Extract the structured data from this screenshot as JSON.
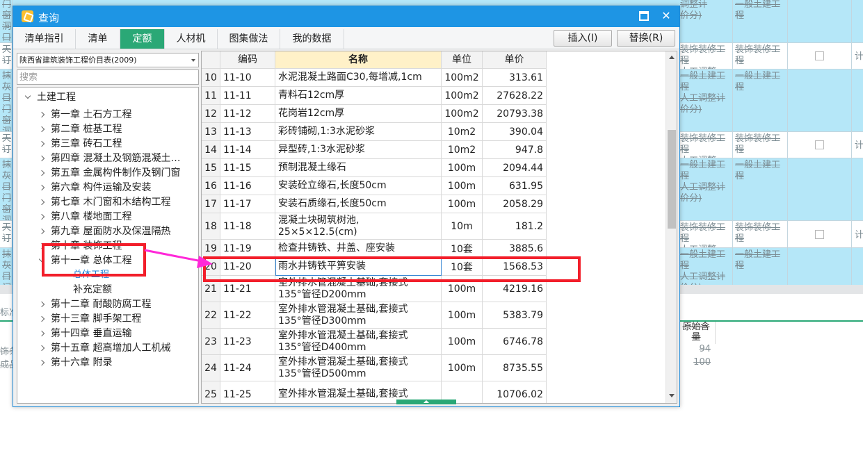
{
  "background": {
    "rows": [
      {
        "col1": "调整计\n价分)",
        "col2": "一般土建工\n程",
        "type": "blue"
      },
      {
        "col1": "装饰装修工程\n人工调整…",
        "col2": "装饰装修工\n程",
        "type": "white"
      },
      {
        "col1": "一般土建工程\n人工调整计\n价分)",
        "col2": "一般土建工\n程",
        "type": "blue"
      },
      {
        "col1": "装饰装修工程\n人工调整…",
        "col2": "装饰装修工\n程",
        "type": "white"
      },
      {
        "col1": "一般土建工程\n人工调整计\n价分)",
        "col2": "一般土建工\n程",
        "type": "blue"
      },
      {
        "col1": "装饰装修工程\n人工调整…",
        "col2": "装饰装修工\n程",
        "type": "white"
      },
      {
        "col1": "一般土建工程\n人工调整计\n价分)",
        "col2": "一般土建工\n程",
        "type": "blue"
      }
    ],
    "left_fragments": [
      "门窗\n洞口\n五金",
      "天订",
      "抹灰\n目\n门窗\n洞口\n五金",
      "天订",
      "抹灰\n目\n门窗\n洞口\n五金",
      "天订",
      "抹灰\n目\n门窗"
    ],
    "right_label": "计",
    "strip_left": "标准",
    "lower": {
      "header": "原始含\n量",
      "values": [
        "94",
        "100"
      ],
      "left_labels": [
        "饰条",
        "成品"
      ]
    }
  },
  "dialog": {
    "title": "查询",
    "minimize_icon": "minimize-icon",
    "close_label": "✕",
    "tabs": [
      {
        "label": "清单指引",
        "active": false
      },
      {
        "label": "清单",
        "active": false
      },
      {
        "label": "定额",
        "active": true
      },
      {
        "label": "人材机",
        "active": false
      },
      {
        "label": "图集做法",
        "active": false
      },
      {
        "label": "我的数据",
        "active": false
      }
    ],
    "insert_button": "插入(I)",
    "replace_button": "替换(R)"
  },
  "left_panel": {
    "library_select": "陕西省建筑装饰工程价目表(2009)",
    "search_placeholder": "搜索",
    "tree": {
      "root": "土建工程",
      "chapters": [
        "第一章 土石方工程",
        "第二章 桩基工程",
        "第三章 砖石工程",
        "第四章 混凝土及钢筋混凝土…",
        "第五章 金属构件制作及钢门窗",
        "第六章 构件运输及安装",
        "第七章 木门窗和木结构工程",
        "第八章 楼地面工程",
        "第九章 屋面防水及保温隔热",
        "第十章 装饰工程",
        "第十一章 总体工程",
        "总体工程",
        "补充定额",
        "第十二章 耐酸防腐工程",
        "第十三章 脚手架工程",
        "第十四章 垂直运输",
        "第十五章 超高增加人工机械",
        "第十六章 附录"
      ]
    }
  },
  "grid": {
    "headers": {
      "index": "",
      "code": "编码",
      "name": "名称",
      "unit": "单位",
      "price": "单价"
    },
    "rows": [
      {
        "idx": "10",
        "code": "11-10",
        "name": "水泥混凝土路面C30,每增减,1cm",
        "unit": "100m2",
        "price": "313.61"
      },
      {
        "idx": "11",
        "code": "11-11",
        "name": "青料石12cm厚",
        "unit": "100m2",
        "price": "27628.22"
      },
      {
        "idx": "12",
        "code": "11-12",
        "name": "花岗岩12cm厚",
        "unit": "100m2",
        "price": "20793.38"
      },
      {
        "idx": "13",
        "code": "11-13",
        "name": "彩砖铺砌,1:3水泥砂浆",
        "unit": "10m2",
        "price": "390.04"
      },
      {
        "idx": "14",
        "code": "11-14",
        "name": "异型砖,1:3水泥砂浆",
        "unit": "10m2",
        "price": "947.8"
      },
      {
        "idx": "15",
        "code": "11-15",
        "name": "预制混凝土缘石",
        "unit": "100m",
        "price": "2094.44"
      },
      {
        "idx": "16",
        "code": "11-16",
        "name": "安装砼立缘石,长度50cm",
        "unit": "100m",
        "price": "631.95"
      },
      {
        "idx": "17",
        "code": "11-17",
        "name": "安装石质缘石,长度50cm",
        "unit": "100m",
        "price": "2058.29"
      },
      {
        "idx": "18",
        "code": "11-18",
        "name": "混凝土块砌筑树池,\n25×5×12.5(cm)",
        "unit": "10m",
        "price": "181.2"
      },
      {
        "idx": "19",
        "code": "11-19",
        "name": "检查井铸铁、井盖、座安装",
        "unit": "10套",
        "price": "3885.6"
      },
      {
        "idx": "20",
        "code": "11-20",
        "name": "雨水井铸铁平箅安装",
        "unit": "10套",
        "price": "1568.53"
      },
      {
        "idx": "21",
        "code": "11-21",
        "name": "室外排水管混凝土基础,套接式\n135°管径D200mm",
        "unit": "100m",
        "price": "4219.16"
      },
      {
        "idx": "22",
        "code": "11-22",
        "name": "室外排水管混凝土基础,套接式\n135°管径D300mm",
        "unit": "100m",
        "price": "5383.79"
      },
      {
        "idx": "23",
        "code": "11-23",
        "name": "室外排水管混凝土基础,套接式\n135°管径D400mm",
        "unit": "100m",
        "price": "6746.78"
      },
      {
        "idx": "24",
        "code": "11-24",
        "name": "室外排水管混凝土基础,套接式\n135°管径D500mm",
        "unit": "100m",
        "price": "8735.55"
      },
      {
        "idx": "25",
        "code": "11-25",
        "name": "室外排水管混凝土基础,套接式",
        "unit": "",
        "price": "10706.02"
      }
    ],
    "selected_row": "20"
  },
  "annotation": {
    "color": "#f21e2a",
    "arrow_color": "#ff28d8"
  }
}
